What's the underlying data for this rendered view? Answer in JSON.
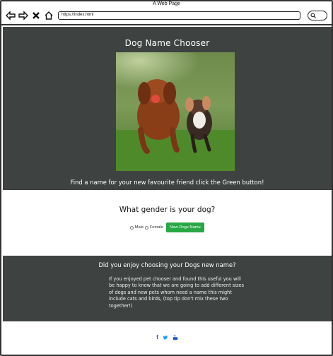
{
  "browser": {
    "window_title": "A Web Page",
    "url": "https://index.html"
  },
  "hero": {
    "title": "Dog Name Chooser",
    "subtitle": "Find a name for your new favourite friend click the Green button!"
  },
  "gender": {
    "question": "What gender is your dog?",
    "options": [
      "Male",
      "Female"
    ],
    "button_label": "New Dogs Name"
  },
  "enjoy": {
    "question": "Did you enjoy choosing your Dogs new name?",
    "lines": [
      "If you enjoyed pet chooser and found this useful you will",
      "be happy to know that we are going to add different sizes",
      "of dogs and new pets whom need a name this might",
      "include cats and birds, (top tip don't mix these two",
      "together!)"
    ]
  },
  "footer": {
    "social_icons": [
      "facebook-icon",
      "twitter-icon",
      "youtube-icon"
    ],
    "facebook_glyph": "f",
    "twitter_color": "#1d9bf0",
    "link_color": "#1a56c7"
  },
  "colors": {
    "dark_band": "#3e4342",
    "button_green": "#28a745"
  }
}
